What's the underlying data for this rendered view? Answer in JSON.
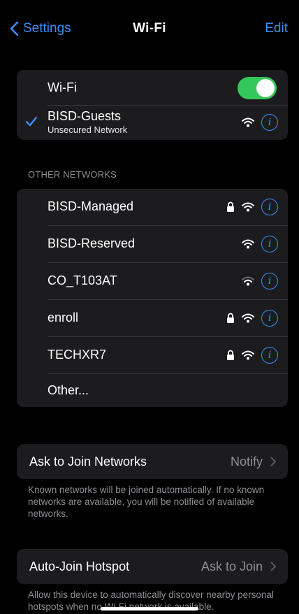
{
  "nav": {
    "back_label": "Settings",
    "title": "Wi-Fi",
    "edit_label": "Edit"
  },
  "wifi_toggle": {
    "label": "Wi-Fi",
    "state": "on"
  },
  "connected": {
    "name": "BISD-Guests",
    "subtitle": "Unsecured Network"
  },
  "other_networks": {
    "header": "OTHER NETWORKS",
    "items": [
      {
        "name": "BISD-Managed",
        "locked": true
      },
      {
        "name": "BISD-Reserved",
        "locked": false
      },
      {
        "name": "CO_T103AT",
        "locked": false
      },
      {
        "name": "enroll",
        "locked": true
      },
      {
        "name": "TECHXR7",
        "locked": true
      }
    ],
    "other_label": "Other..."
  },
  "ask_to_join": {
    "label": "Ask to Join Networks",
    "value": "Notify",
    "footnote": "Known networks will be joined automatically. If no known networks are available, you will be notified of available networks."
  },
  "auto_join": {
    "label": "Auto-Join Hotspot",
    "value": "Ask to Join",
    "footnote": "Allow this device to automatically discover nearby personal hotspots when no Wi-Fi network is available."
  },
  "colors": {
    "accent": "#3a8ff7",
    "toggle_on": "#34c759",
    "cell_bg": "#1c1c1e",
    "secondary_text": "#8e8e93"
  }
}
